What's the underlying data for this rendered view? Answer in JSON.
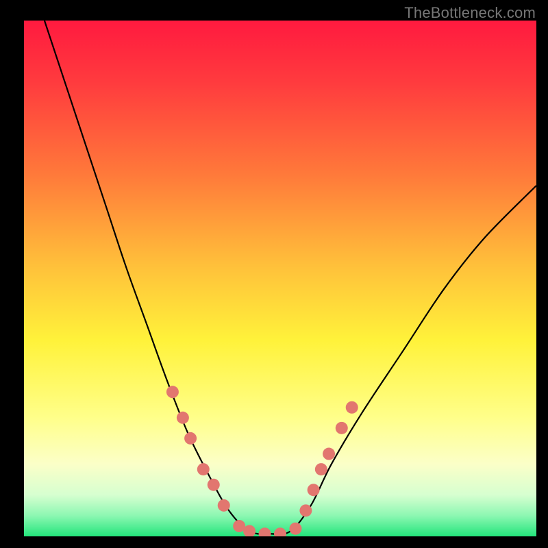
{
  "watermark": "TheBottleneck.com",
  "chart_data": {
    "type": "line",
    "title": "",
    "xlabel": "",
    "ylabel": "",
    "xlim": [
      0,
      100
    ],
    "ylim": [
      0,
      100
    ],
    "background_gradient": {
      "stops": [
        {
          "offset": 0.0,
          "color": "#ff1a3f"
        },
        {
          "offset": 0.12,
          "color": "#ff3b3e"
        },
        {
          "offset": 0.3,
          "color": "#ff7a3a"
        },
        {
          "offset": 0.48,
          "color": "#ffc23a"
        },
        {
          "offset": 0.62,
          "color": "#fff23a"
        },
        {
          "offset": 0.77,
          "color": "#ffff8a"
        },
        {
          "offset": 0.86,
          "color": "#fbffc8"
        },
        {
          "offset": 0.92,
          "color": "#d6ffd0"
        },
        {
          "offset": 0.96,
          "color": "#8cf7b2"
        },
        {
          "offset": 1.0,
          "color": "#23e57b"
        }
      ]
    },
    "series": [
      {
        "name": "bottleneck-curve",
        "type": "line",
        "points": [
          {
            "x": 4,
            "y": 100
          },
          {
            "x": 8,
            "y": 88
          },
          {
            "x": 12,
            "y": 76
          },
          {
            "x": 16,
            "y": 64
          },
          {
            "x": 20,
            "y": 52
          },
          {
            "x": 24,
            "y": 41
          },
          {
            "x": 28,
            "y": 30
          },
          {
            "x": 32,
            "y": 20
          },
          {
            "x": 36,
            "y": 12
          },
          {
            "x": 40,
            "y": 5
          },
          {
            "x": 44,
            "y": 1
          },
          {
            "x": 48,
            "y": 0.5
          },
          {
            "x": 52,
            "y": 1
          },
          {
            "x": 56,
            "y": 6
          },
          {
            "x": 60,
            "y": 14
          },
          {
            "x": 66,
            "y": 24
          },
          {
            "x": 74,
            "y": 36
          },
          {
            "x": 82,
            "y": 48
          },
          {
            "x": 90,
            "y": 58
          },
          {
            "x": 100,
            "y": 68
          }
        ]
      },
      {
        "name": "sample-dots",
        "type": "scatter",
        "color": "#e2766f",
        "points": [
          {
            "x": 29,
            "y": 28
          },
          {
            "x": 31,
            "y": 23
          },
          {
            "x": 32.5,
            "y": 19
          },
          {
            "x": 35,
            "y": 13
          },
          {
            "x": 37,
            "y": 10
          },
          {
            "x": 39,
            "y": 6
          },
          {
            "x": 42,
            "y": 2
          },
          {
            "x": 44,
            "y": 1
          },
          {
            "x": 47,
            "y": 0.5
          },
          {
            "x": 50,
            "y": 0.5
          },
          {
            "x": 53,
            "y": 1.5
          },
          {
            "x": 55,
            "y": 5
          },
          {
            "x": 56.5,
            "y": 9
          },
          {
            "x": 58,
            "y": 13
          },
          {
            "x": 59.5,
            "y": 16
          },
          {
            "x": 62,
            "y": 21
          },
          {
            "x": 64,
            "y": 25
          }
        ]
      }
    ]
  }
}
